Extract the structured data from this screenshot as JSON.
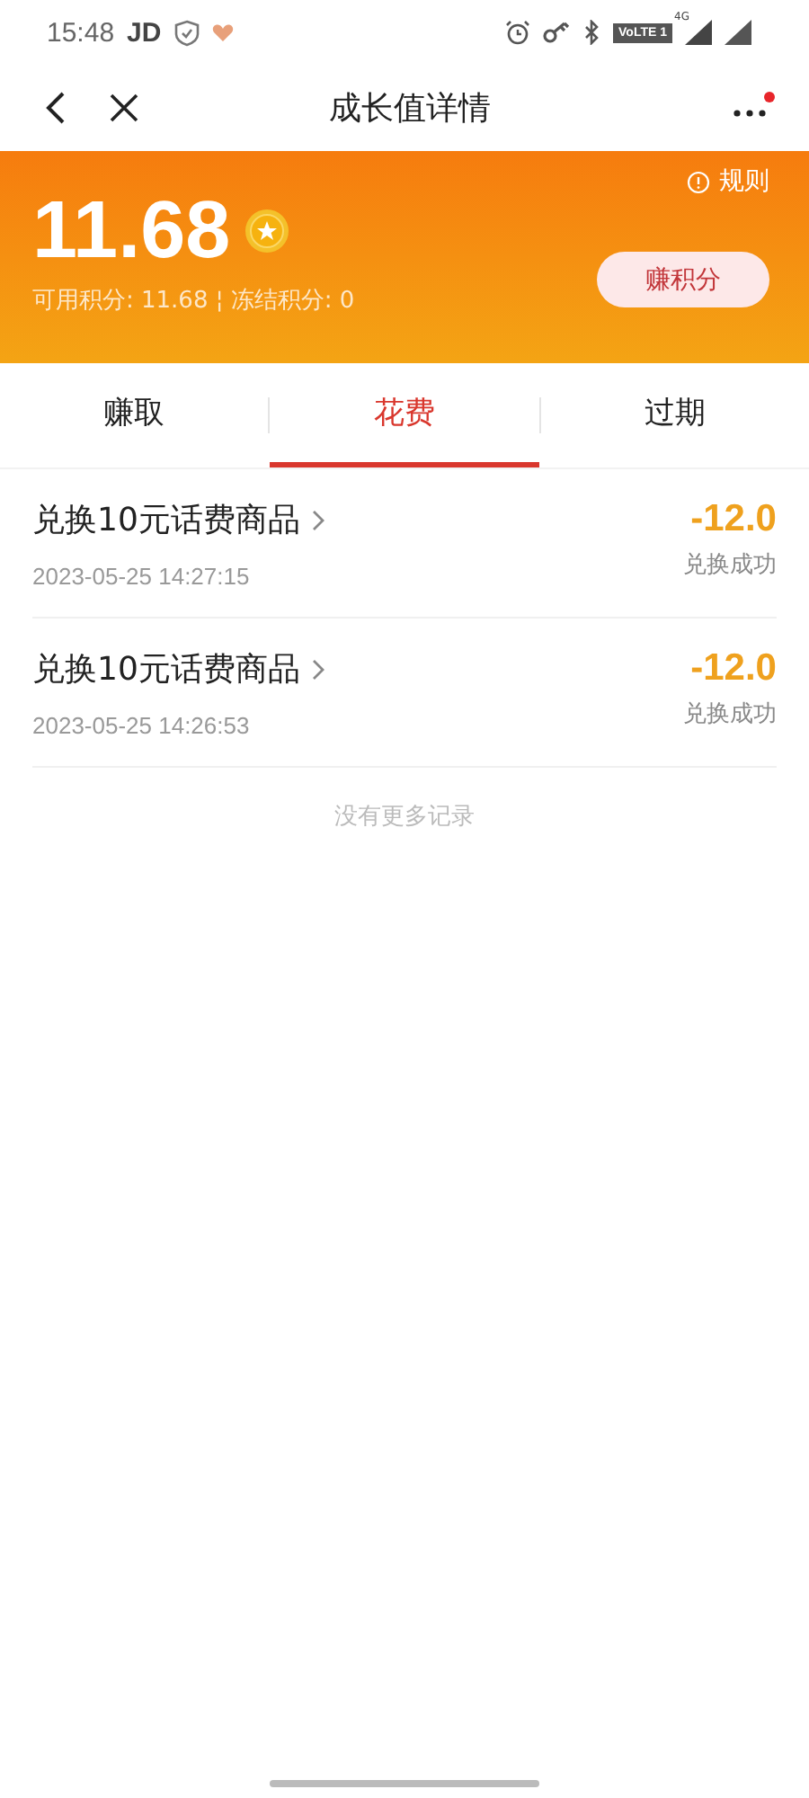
{
  "status_bar": {
    "time": "15:48",
    "carrier": "JD",
    "volte": "VoLTE 1",
    "network": "4G"
  },
  "nav": {
    "title": "成长值详情",
    "menu_badge": true
  },
  "header": {
    "points": "11.68",
    "rules": "规则",
    "summary": "可用积分: 11.68 ¦ 冻结积分: 0",
    "earn_button": "赚积分"
  },
  "tabs": [
    {
      "label": "赚取",
      "selected": false
    },
    {
      "label": "花费",
      "selected": true
    },
    {
      "label": "过期",
      "selected": false
    }
  ],
  "records": [
    {
      "title": "兑换10元话费商品",
      "time": "2023-05-25 14:27:15",
      "amount": "-12.0",
      "status": "兑换成功"
    },
    {
      "title": "兑换10元话费商品",
      "time": "2023-05-25 14:26:53",
      "amount": "-12.0",
      "status": "兑换成功"
    }
  ],
  "footer_note": "没有更多记录"
}
